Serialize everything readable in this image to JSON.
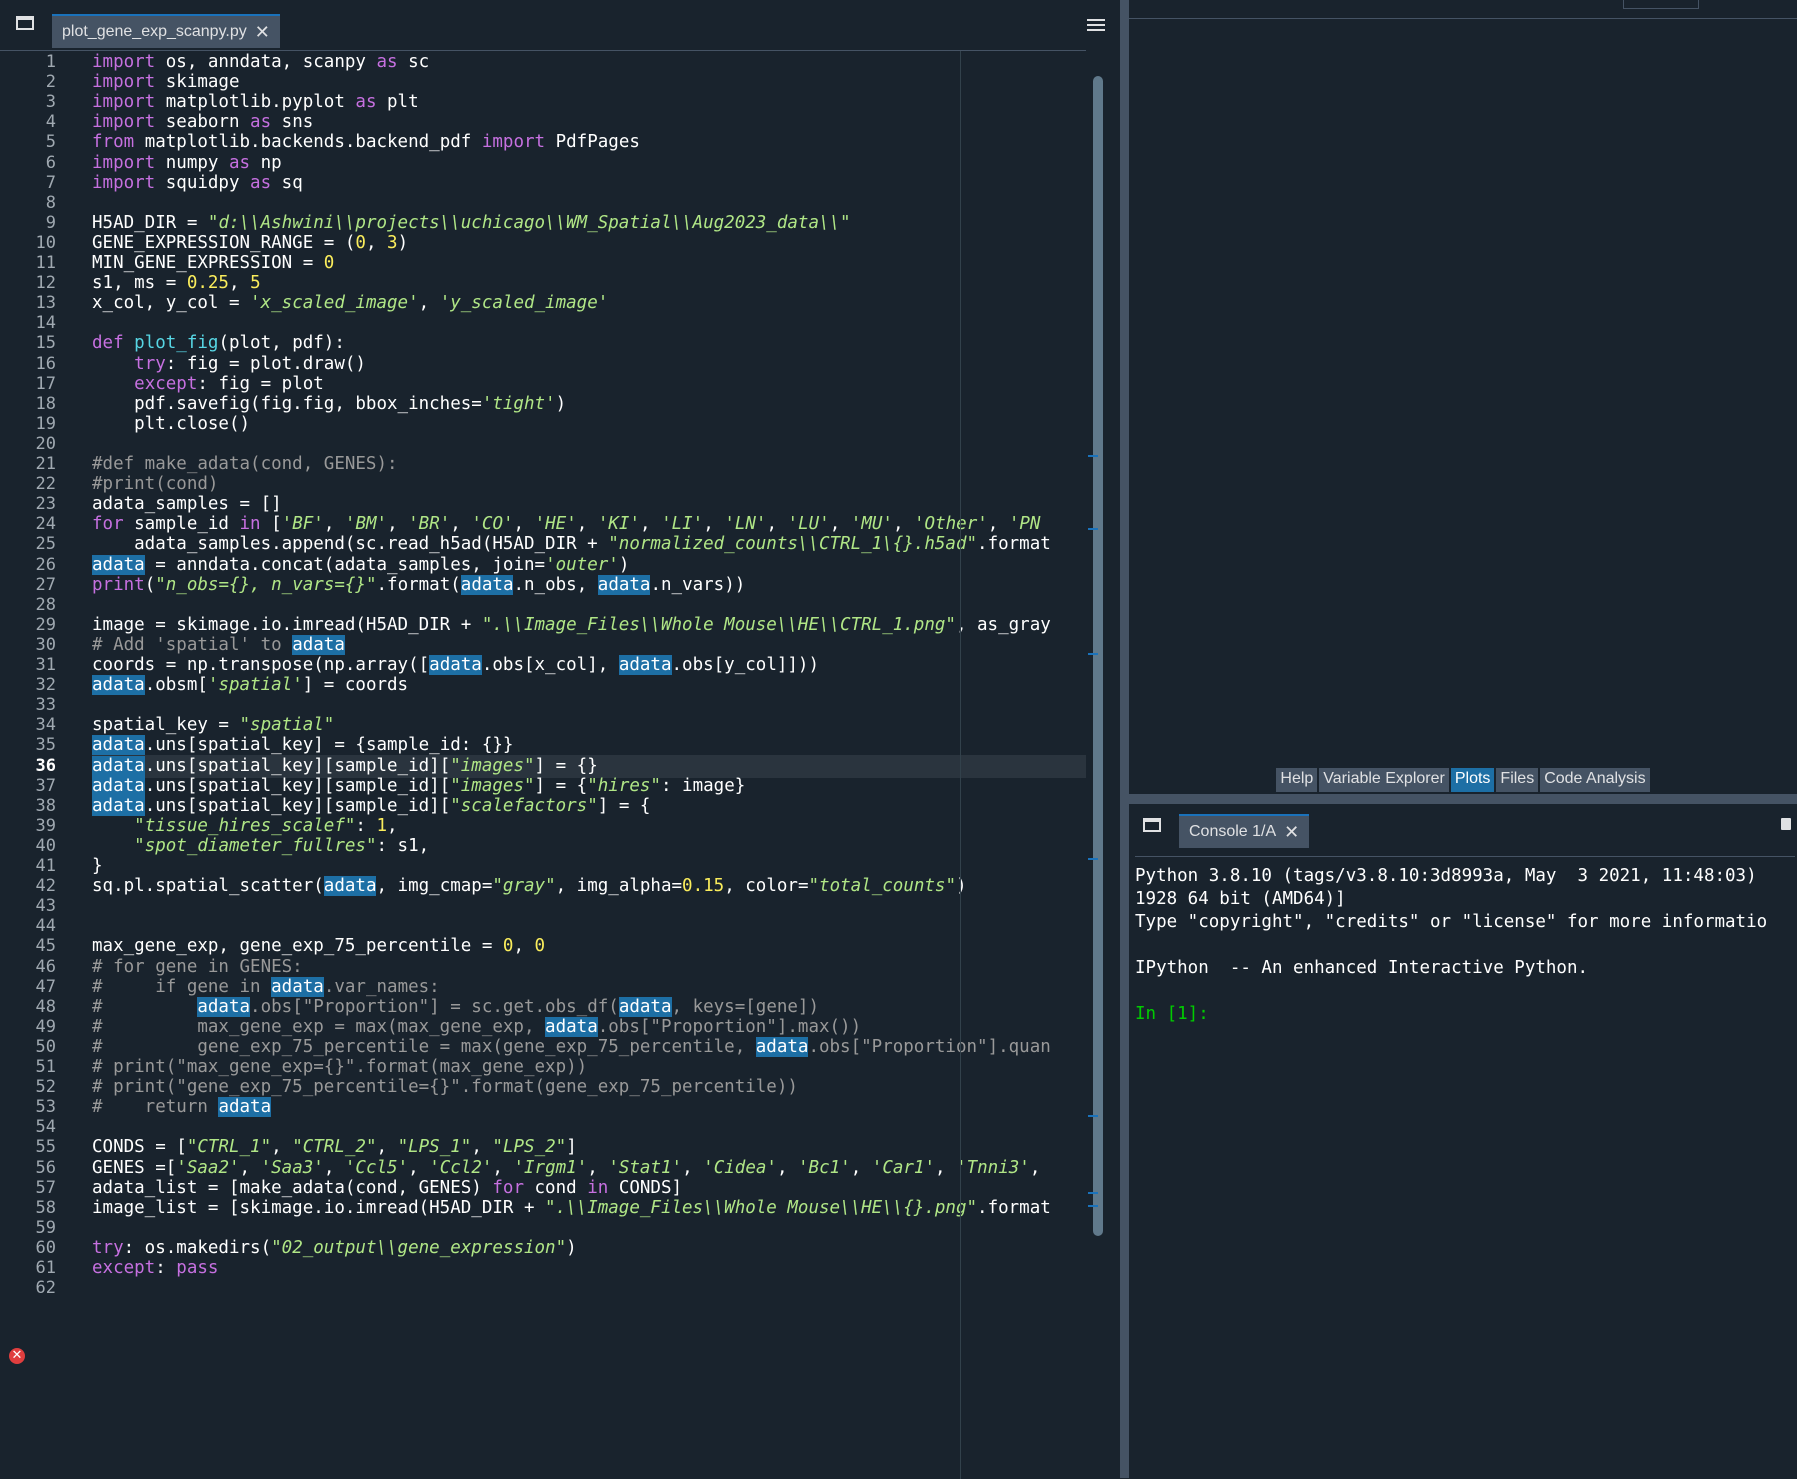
{
  "editor": {
    "tab_label": "plot_gene_exp_scanpy.py",
    "current_line": 36,
    "error_line": 57,
    "code": [
      [
        [
          "k",
          "import"
        ],
        [
          "t",
          " os, anndata, scanpy "
        ],
        [
          "k",
          "as"
        ],
        [
          "t",
          " sc"
        ]
      ],
      [
        [
          "k",
          "import"
        ],
        [
          "t",
          " skimage"
        ]
      ],
      [
        [
          "k",
          "import"
        ],
        [
          "t",
          " matplotlib.pyplot "
        ],
        [
          "k",
          "as"
        ],
        [
          "t",
          " plt"
        ]
      ],
      [
        [
          "k",
          "import"
        ],
        [
          "t",
          " seaborn "
        ],
        [
          "k",
          "as"
        ],
        [
          "t",
          " sns"
        ]
      ],
      [
        [
          "k",
          "from"
        ],
        [
          "t",
          " matplotlib.backends.backend_pdf "
        ],
        [
          "k",
          "import"
        ],
        [
          "t",
          " PdfPages"
        ]
      ],
      [
        [
          "k",
          "import"
        ],
        [
          "t",
          " numpy "
        ],
        [
          "k",
          "as"
        ],
        [
          "t",
          " np"
        ]
      ],
      [
        [
          "k",
          "import"
        ],
        [
          "t",
          " squidpy "
        ],
        [
          "k",
          "as"
        ],
        [
          "t",
          " sq"
        ]
      ],
      [],
      [
        [
          "t",
          "H5AD_DIR = "
        ],
        [
          "s",
          "\"d:\\\\Ashwini\\\\projects\\\\uchicago\\\\WM_Spatial\\\\Aug2023_data\\\\\""
        ]
      ],
      [
        [
          "t",
          "GENE_EXPRESSION_RANGE = ("
        ],
        [
          "n",
          "0"
        ],
        [
          "t",
          ", "
        ],
        [
          "n",
          "3"
        ],
        [
          "t",
          ")"
        ]
      ],
      [
        [
          "t",
          "MIN_GENE_EXPRESSION = "
        ],
        [
          "n",
          "0"
        ]
      ],
      [
        [
          "t",
          "s1, ms = "
        ],
        [
          "n",
          "0.25"
        ],
        [
          "t",
          ", "
        ],
        [
          "n",
          "5"
        ]
      ],
      [
        [
          "t",
          "x_col, y_col = "
        ],
        [
          "s",
          "'x_scaled_image'"
        ],
        [
          "t",
          ", "
        ],
        [
          "s",
          "'y_scaled_image'"
        ]
      ],
      [],
      [
        [
          "k",
          "def"
        ],
        [
          "t",
          " "
        ],
        [
          "f",
          "plot_fig"
        ],
        [
          "t",
          "(plot, pdf):"
        ]
      ],
      [
        [
          "t",
          "    "
        ],
        [
          "k",
          "try"
        ],
        [
          "t",
          ": fig = plot.draw()"
        ]
      ],
      [
        [
          "t",
          "    "
        ],
        [
          "k",
          "except"
        ],
        [
          "t",
          ": fig = plot"
        ]
      ],
      [
        [
          "t",
          "    pdf.savefig(fig.fig, bbox_inches="
        ],
        [
          "s",
          "'tight'"
        ],
        [
          "t",
          ")"
        ]
      ],
      [
        [
          "t",
          "    plt.close()"
        ]
      ],
      [],
      [
        [
          "c",
          "#def make_adata(cond, GENES):"
        ]
      ],
      [
        [
          "c",
          "#print(cond)"
        ]
      ],
      [
        [
          "t",
          "adata_samples = []"
        ]
      ],
      [
        [
          "k",
          "for"
        ],
        [
          "t",
          " sample_id "
        ],
        [
          "k",
          "in"
        ],
        [
          "t",
          " ["
        ],
        [
          "s",
          "'BF'"
        ],
        [
          "t",
          ", "
        ],
        [
          "s",
          "'BM'"
        ],
        [
          "t",
          ", "
        ],
        [
          "s",
          "'BR'"
        ],
        [
          "t",
          ", "
        ],
        [
          "s",
          "'CO'"
        ],
        [
          "t",
          ", "
        ],
        [
          "s",
          "'HE'"
        ],
        [
          "t",
          ", "
        ],
        [
          "s",
          "'KI'"
        ],
        [
          "t",
          ", "
        ],
        [
          "s",
          "'LI'"
        ],
        [
          "t",
          ", "
        ],
        [
          "s",
          "'LN'"
        ],
        [
          "t",
          ", "
        ],
        [
          "s",
          "'LU'"
        ],
        [
          "t",
          ", "
        ],
        [
          "s",
          "'MU'"
        ],
        [
          "t",
          ", "
        ],
        [
          "s",
          "'Other'"
        ],
        [
          "t",
          ", "
        ],
        [
          "s",
          "'PN"
        ]
      ],
      [
        [
          "t",
          "    adata_samples.append(sc.read_h5ad(H5AD_DIR + "
        ],
        [
          "s",
          "\"normalized_counts\\\\CTRL_1\\{}.h5ad\""
        ],
        [
          "t",
          ".format"
        ]
      ],
      [
        [
          "m",
          "adata"
        ],
        [
          "t",
          " = anndata.concat(adata_samples, join="
        ],
        [
          "s",
          "'outer'"
        ],
        [
          "t",
          ")"
        ]
      ],
      [
        [
          "b",
          "print"
        ],
        [
          "t",
          "("
        ],
        [
          "s",
          "\"n_obs={}, n_vars={}\""
        ],
        [
          "t",
          ".format("
        ],
        [
          "m",
          "adata"
        ],
        [
          "t",
          ".n_obs, "
        ],
        [
          "m",
          "adata"
        ],
        [
          "t",
          ".n_vars))"
        ]
      ],
      [],
      [
        [
          "t",
          "image = skimage.io.imread(H5AD_DIR + "
        ],
        [
          "s",
          "\".\\\\Image_Files\\\\Whole Mouse\\\\HE\\\\CTRL_1.png\""
        ],
        [
          "t",
          ", as_gray"
        ]
      ],
      [
        [
          "c",
          "# Add 'spatial' to "
        ],
        [
          "m",
          "adata"
        ]
      ],
      [
        [
          "t",
          "coords = np.transpose(np.array(["
        ],
        [
          "m",
          "adata"
        ],
        [
          "t",
          ".obs[x_col], "
        ],
        [
          "m",
          "adata"
        ],
        [
          "t",
          ".obs[y_col]]))"
        ]
      ],
      [
        [
          "m",
          "adata"
        ],
        [
          "t",
          ".obsm["
        ],
        [
          "s",
          "'spatial'"
        ],
        [
          "t",
          "] = coords"
        ]
      ],
      [],
      [
        [
          "t",
          "spatial_key = "
        ],
        [
          "s",
          "\"spatial\""
        ]
      ],
      [
        [
          "m",
          "adata"
        ],
        [
          "t",
          ".uns[spatial_key] = {sample_id: {}}"
        ]
      ],
      [
        [
          "m",
          "adata"
        ],
        [
          "t",
          ".uns[spatial_key][sample_id]["
        ],
        [
          "s",
          "\"images\""
        ],
        [
          "t",
          "] = {}"
        ]
      ],
      [
        [
          "m",
          "adata"
        ],
        [
          "t",
          ".uns[spatial_key][sample_id]["
        ],
        [
          "s",
          "\"images\""
        ],
        [
          "t",
          "] = {"
        ],
        [
          "s",
          "\"hires\""
        ],
        [
          "t",
          ": image}"
        ]
      ],
      [
        [
          "m",
          "adata"
        ],
        [
          "t",
          ".uns[spatial_key][sample_id]["
        ],
        [
          "s",
          "\"scalefactors\""
        ],
        [
          "t",
          "] = {"
        ]
      ],
      [
        [
          "t",
          "    "
        ],
        [
          "s",
          "\"tissue_hires_scalef\""
        ],
        [
          "t",
          ": "
        ],
        [
          "n",
          "1"
        ],
        [
          "t",
          ","
        ]
      ],
      [
        [
          "t",
          "    "
        ],
        [
          "s",
          "\"spot_diameter_fullres\""
        ],
        [
          "t",
          ": s1,"
        ]
      ],
      [
        [
          "t",
          "}"
        ]
      ],
      [
        [
          "t",
          "sq.pl.spatial_scatter("
        ],
        [
          "m",
          "adata"
        ],
        [
          "t",
          ", img_cmap="
        ],
        [
          "s",
          "\"gray\""
        ],
        [
          "t",
          ", img_alpha="
        ],
        [
          "n",
          "0.15"
        ],
        [
          "t",
          ", color="
        ],
        [
          "s",
          "\"total_counts\""
        ],
        [
          "t",
          ")"
        ]
      ],
      [],
      [],
      [
        [
          "t",
          "max_gene_exp, gene_exp_75_percentile = "
        ],
        [
          "n",
          "0"
        ],
        [
          "t",
          ", "
        ],
        [
          "n",
          "0"
        ]
      ],
      [
        [
          "c",
          "# for gene in GENES:"
        ]
      ],
      [
        [
          "c",
          "#     if gene in "
        ],
        [
          "m",
          "adata"
        ],
        [
          "c",
          ".var_names:"
        ]
      ],
      [
        [
          "c",
          "#         "
        ],
        [
          "m",
          "adata"
        ],
        [
          "c",
          ".obs[\"Proportion\"] = sc.get.obs_df("
        ],
        [
          "m",
          "adata"
        ],
        [
          "c",
          ", keys=[gene])"
        ]
      ],
      [
        [
          "c",
          "#         max_gene_exp = max(max_gene_exp, "
        ],
        [
          "m",
          "adata"
        ],
        [
          "c",
          ".obs[\"Proportion\"].max())"
        ]
      ],
      [
        [
          "c",
          "#         gene_exp_75_percentile = max(gene_exp_75_percentile, "
        ],
        [
          "m",
          "adata"
        ],
        [
          "c",
          ".obs[\"Proportion\"].quan"
        ]
      ],
      [
        [
          "c",
          "# print(\"max_gene_exp={}\".format(max_gene_exp))"
        ]
      ],
      [
        [
          "c",
          "# print(\"gene_exp_75_percentile={}\".format(gene_exp_75_percentile))"
        ]
      ],
      [
        [
          "c",
          "#    return "
        ],
        [
          "m",
          "adata"
        ]
      ],
      [],
      [
        [
          "t",
          "CONDS = ["
        ],
        [
          "s",
          "\"CTRL_1\""
        ],
        [
          "t",
          ", "
        ],
        [
          "s",
          "\"CTRL_2\""
        ],
        [
          "t",
          ", "
        ],
        [
          "s",
          "\"LPS_1\""
        ],
        [
          "t",
          ", "
        ],
        [
          "s",
          "\"LPS_2\""
        ],
        [
          "t",
          "]"
        ]
      ],
      [
        [
          "t",
          "GENES =["
        ],
        [
          "s",
          "'Saa2'"
        ],
        [
          "t",
          ", "
        ],
        [
          "s",
          "'Saa3'"
        ],
        [
          "t",
          ", "
        ],
        [
          "s",
          "'Ccl5'"
        ],
        [
          "t",
          ", "
        ],
        [
          "s",
          "'Ccl2'"
        ],
        [
          "t",
          ", "
        ],
        [
          "s",
          "'Irgm1'"
        ],
        [
          "t",
          ", "
        ],
        [
          "s",
          "'Stat1'"
        ],
        [
          "t",
          ", "
        ],
        [
          "s",
          "'Cidea'"
        ],
        [
          "t",
          ", "
        ],
        [
          "s",
          "'Bc1'"
        ],
        [
          "t",
          ", "
        ],
        [
          "s",
          "'Car1'"
        ],
        [
          "t",
          ", "
        ],
        [
          "s",
          "'Tnni3'"
        ],
        [
          "t",
          ","
        ]
      ],
      [
        [
          "t",
          "adata_list = [make_adata(cond, GENES) "
        ],
        [
          "k",
          "for"
        ],
        [
          "t",
          " cond "
        ],
        [
          "k",
          "in"
        ],
        [
          "t",
          " CONDS]"
        ]
      ],
      [
        [
          "t",
          "image_list = [skimage.io.imread(H5AD_DIR + "
        ],
        [
          "s",
          "\".\\\\Image_Files\\\\Whole Mouse\\\\HE\\\\{}.png\""
        ],
        [
          "t",
          ".format"
        ]
      ],
      [],
      [
        [
          "k",
          "try"
        ],
        [
          "t",
          ": os.makedirs("
        ],
        [
          "s",
          "\"02_output\\\\gene_expression\""
        ],
        [
          "t",
          ")"
        ]
      ],
      [
        [
          "k",
          "except"
        ],
        [
          "t",
          ": "
        ],
        [
          "k",
          "pass"
        ]
      ],
      []
    ]
  },
  "right_tabs": {
    "help": "Help",
    "variable_explorer": "Variable Explorer",
    "plots": "Plots",
    "files": "Files",
    "code_analysis": "Code Analysis",
    "active": "Plots"
  },
  "console": {
    "tab_label": "Console 1/A",
    "lines": [
      "Python 3.8.10 (tags/v3.8.10:3d8993a, May  3 2021, 11:48:03)",
      "1928 64 bit (AMD64)]",
      "Type \"copyright\", \"credits\" or \"license\" for more informatio",
      "",
      "IPython  -- An enhanced Interactive Python.",
      ""
    ],
    "prompt": "In [1]:"
  },
  "colors": {
    "background": "#19232d",
    "keyword": "#c670e0",
    "string": "#b0e686",
    "number": "#faed5c",
    "comment": "#999999",
    "function": "#57d6e4",
    "occurrence_highlight": "#1d6fa5",
    "prompt": "#00cc00"
  }
}
